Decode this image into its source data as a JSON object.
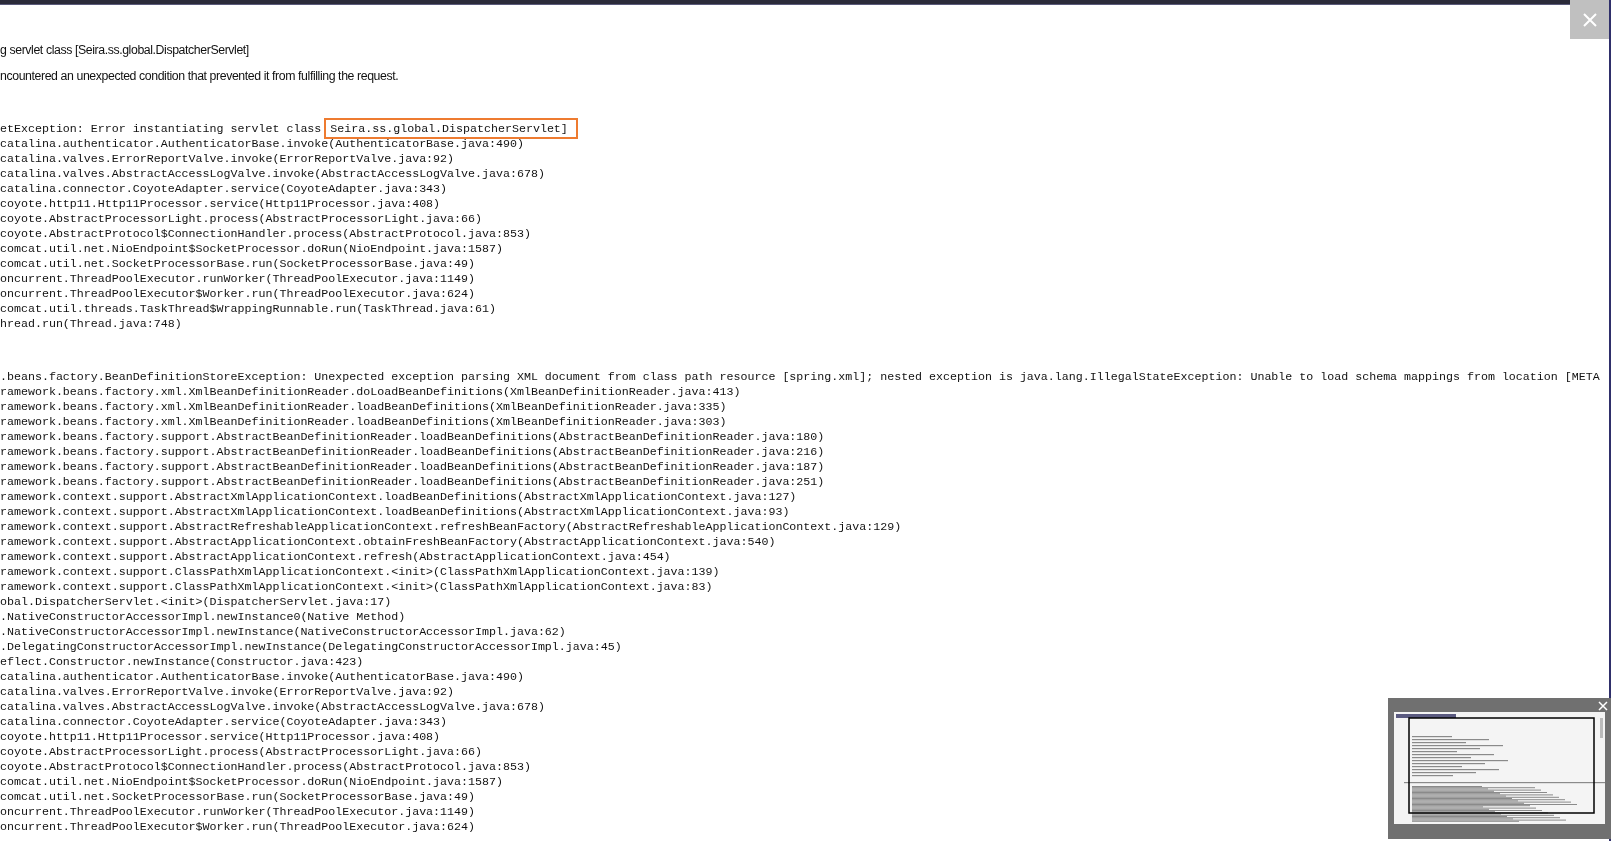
{
  "message_lines": [
    "g servlet class [Seira.ss.global.DispatcherServlet]",
    "ncountered an unexpected condition that prevented it from fulfilling the request."
  ],
  "stack_traces": [
    {
      "lines": [
        {
          "text": "etException: Error instantiating servlet class ",
          "highlighted": "Seira.ss.global.DispatcherServlet]"
        },
        {
          "text": "catalina.authenticator.AuthenticatorBase.invoke(AuthenticatorBase.java:490)"
        },
        {
          "text": "catalina.valves.ErrorReportValve.invoke(ErrorReportValve.java:92)"
        },
        {
          "text": "catalina.valves.AbstractAccessLogValve.invoke(AbstractAccessLogValve.java:678)"
        },
        {
          "text": "catalina.connector.CoyoteAdapter.service(CoyoteAdapter.java:343)"
        },
        {
          "text": "coyote.http11.Http11Processor.service(Http11Processor.java:408)"
        },
        {
          "text": "coyote.AbstractProcessorLight.process(AbstractProcessorLight.java:66)"
        },
        {
          "text": "coyote.AbstractProtocol$ConnectionHandler.process(AbstractProtocol.java:853)"
        },
        {
          "text": "comcat.util.net.NioEndpoint$SocketProcessor.doRun(NioEndpoint.java:1587)"
        },
        {
          "text": "comcat.util.net.SocketProcessorBase.run(SocketProcessorBase.java:49)"
        },
        {
          "text": "oncurrent.ThreadPoolExecutor.runWorker(ThreadPoolExecutor.java:1149)"
        },
        {
          "text": "oncurrent.ThreadPoolExecutor$Worker.run(ThreadPoolExecutor.java:624)"
        },
        {
          "text": "comcat.util.threads.TaskThread$WrappingRunnable.run(TaskThread.java:61)"
        },
        {
          "text": "hread.run(Thread.java:748)"
        }
      ]
    },
    {
      "lines": [
        {
          "text": ".beans.factory.BeanDefinitionStoreException: Unexpected exception parsing XML document from class path resource [spring.xml]; nested exception is java.lang.IllegalStateException: Unable to load schema mappings from location [META"
        },
        {
          "text": "ramework.beans.factory.xml.XmlBeanDefinitionReader.doLoadBeanDefinitions(XmlBeanDefinitionReader.java:413)"
        },
        {
          "text": "ramework.beans.factory.xml.XmlBeanDefinitionReader.loadBeanDefinitions(XmlBeanDefinitionReader.java:335)"
        },
        {
          "text": "ramework.beans.factory.xml.XmlBeanDefinitionReader.loadBeanDefinitions(XmlBeanDefinitionReader.java:303)"
        },
        {
          "text": "ramework.beans.factory.support.AbstractBeanDefinitionReader.loadBeanDefinitions(AbstractBeanDefinitionReader.java:180)"
        },
        {
          "text": "ramework.beans.factory.support.AbstractBeanDefinitionReader.loadBeanDefinitions(AbstractBeanDefinitionReader.java:216)"
        },
        {
          "text": "ramework.beans.factory.support.AbstractBeanDefinitionReader.loadBeanDefinitions(AbstractBeanDefinitionReader.java:187)"
        },
        {
          "text": "ramework.beans.factory.support.AbstractBeanDefinitionReader.loadBeanDefinitions(AbstractBeanDefinitionReader.java:251)"
        },
        {
          "text": "ramework.context.support.AbstractXmlApplicationContext.loadBeanDefinitions(AbstractXmlApplicationContext.java:127)"
        },
        {
          "text": "ramework.context.support.AbstractXmlApplicationContext.loadBeanDefinitions(AbstractXmlApplicationContext.java:93)"
        },
        {
          "text": "ramework.context.support.AbstractRefreshableApplicationContext.refreshBeanFactory(AbstractRefreshableApplicationContext.java:129)"
        },
        {
          "text": "ramework.context.support.AbstractApplicationContext.obtainFreshBeanFactory(AbstractApplicationContext.java:540)"
        },
        {
          "text": "ramework.context.support.AbstractApplicationContext.refresh(AbstractApplicationContext.java:454)"
        },
        {
          "text": "ramework.context.support.ClassPathXmlApplicationContext.<init>(ClassPathXmlApplicationContext.java:139)"
        },
        {
          "text": "ramework.context.support.ClassPathXmlApplicationContext.<init>(ClassPathXmlApplicationContext.java:83)"
        },
        {
          "text": "obal.DispatcherServlet.<init>(DispatcherServlet.java:17)"
        },
        {
          "text": ".NativeConstructorAccessorImpl.newInstance0(Native Method)"
        },
        {
          "text": ".NativeConstructorAccessorImpl.newInstance(NativeConstructorAccessorImpl.java:62)"
        },
        {
          "text": ".DelegatingConstructorAccessorImpl.newInstance(DelegatingConstructorAccessorImpl.java:45)"
        },
        {
          "text": "eflect.Constructor.newInstance(Constructor.java:423)"
        },
        {
          "text": "catalina.authenticator.AuthenticatorBase.invoke(AuthenticatorBase.java:490)"
        },
        {
          "text": "catalina.valves.ErrorReportValve.invoke(ErrorReportValve.java:92)"
        },
        {
          "text": "catalina.valves.AbstractAccessLogValve.invoke(AbstractAccessLogValve.java:678)"
        },
        {
          "text": "catalina.connector.CoyoteAdapter.service(CoyoteAdapter.java:343)"
        },
        {
          "text": "coyote.http11.Http11Processor.service(Http11Processor.java:408)"
        },
        {
          "text": "coyote.AbstractProcessorLight.process(AbstractProcessorLight.java:66)"
        },
        {
          "text": "coyote.AbstractProtocol$ConnectionHandler.process(AbstractProtocol.java:853)"
        },
        {
          "text": "comcat.util.net.NioEndpoint$SocketProcessor.doRun(NioEndpoint.java:1587)"
        },
        {
          "text": "comcat.util.net.SocketProcessorBase.run(SocketProcessorBase.java:49)"
        },
        {
          "text": "oncurrent.ThreadPoolExecutor.runWorker(ThreadPoolExecutor.java:1149)"
        },
        {
          "text": "oncurrent.ThreadPoolExecutor$Worker.run(ThreadPoolExecutor.java:624)"
        }
      ]
    }
  ]
}
